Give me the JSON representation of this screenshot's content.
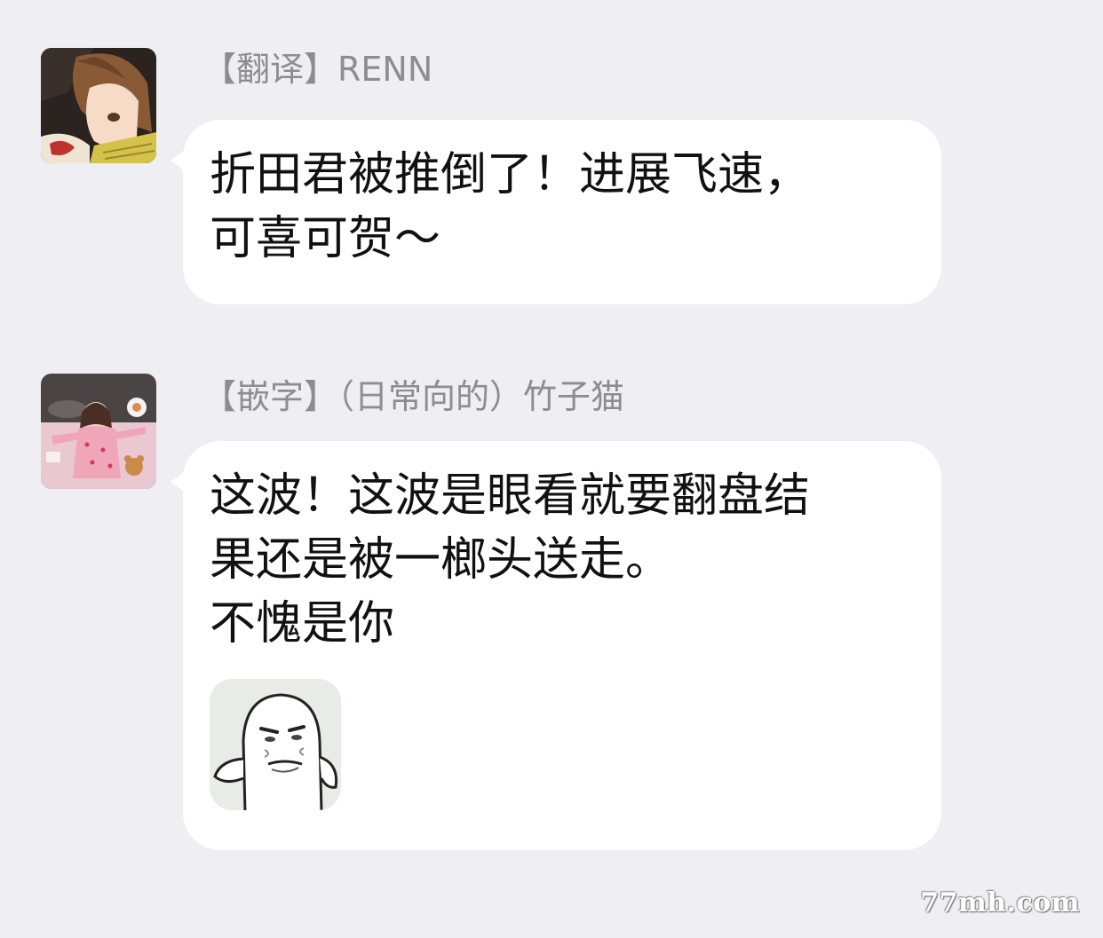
{
  "messages": [
    {
      "sender": "【翻译】RENN",
      "avatar": "anime-boy-avatar",
      "lines": [
        "折田君被推倒了！进展飞速，",
        "可喜可贺～"
      ]
    },
    {
      "sender": "【嵌字】（日常向的）竹子猫",
      "avatar": "girl-in-bed-avatar",
      "lines": [
        "这波！这波是眼看就要翻盘结",
        "果还是被一榔头送走。",
        "不愧是你"
      ],
      "sticker": "smug-blob-sticker"
    }
  ],
  "watermark": "77mh.com",
  "colors": {
    "background": "#eeeef3",
    "bubble": "#ffffff",
    "sender_text": "#8c8c92",
    "message_text": "#111111"
  }
}
